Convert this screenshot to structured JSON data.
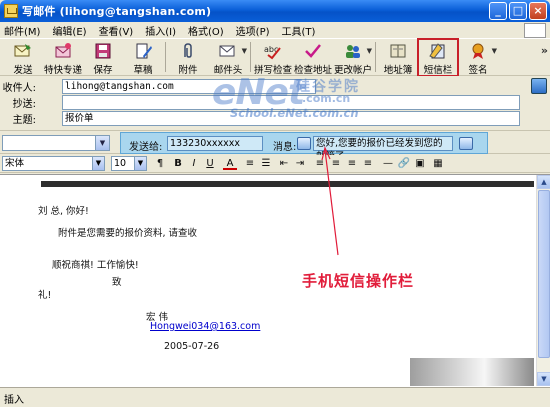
{
  "window": {
    "title": "写邮件 (lihong@tangshan.com)"
  },
  "menu": [
    "邮件(M)",
    "编辑(E)",
    "查看(V)",
    "插入(I)",
    "格式(O)",
    "选项(P)",
    "工具(T)"
  ],
  "toolbar": [
    {
      "label": "发送",
      "icon": "send-icon"
    },
    {
      "label": "特快专递",
      "icon": "express-icon"
    },
    {
      "label": "保存",
      "icon": "save-icon"
    },
    {
      "label": "草稿",
      "icon": "draft-icon"
    },
    {
      "label": "附件",
      "icon": "attachment-icon"
    },
    {
      "label": "邮件头",
      "icon": "mail-header-icon"
    },
    {
      "label": "拼写检查",
      "icon": "spellcheck-icon"
    },
    {
      "label": "检查地址",
      "icon": "check-address-icon"
    },
    {
      "label": "更改帐户",
      "icon": "change-account-icon"
    },
    {
      "label": "地址簿",
      "icon": "address-book-icon"
    },
    {
      "label": "短信栏",
      "icon": "sms-bar-icon"
    },
    {
      "label": "签名",
      "icon": "signature-icon"
    }
  ],
  "header": {
    "to_label": "收件人:",
    "to_value": "lihong@tangshan.com",
    "cc_label": "抄送:",
    "cc_value": "",
    "subject_label": "主题:",
    "subject_value": "报价单"
  },
  "sms": {
    "sender_label": "发送给:",
    "sender_value": "133230xxxxxx",
    "message_label": "消息:",
    "message_value": "您好,您要的报价已经发到您的邮箱了"
  },
  "format": {
    "font": "宋体",
    "size": "10"
  },
  "body": {
    "greeting": "刘 总, 你好!",
    "line1": "附件是您需要的报价资料, 请查收",
    "line2": "顺祝商祺! 工作愉快!",
    "closing1": "致",
    "closing2": "礼!",
    "sender_name": "宏 伟",
    "sender_email": "Hongwei034@163.com",
    "date": "2005-07-26"
  },
  "annotation": "手机短信操作栏",
  "watermark": {
    "brand": "eNet",
    "cn": "硅谷学院",
    "cn_domain": ".com.cn",
    "site": "School.eNet.com.cn"
  },
  "status": "插入",
  "colors": {
    "titlebar": "#0a5fd8",
    "highlight": "#c8202a",
    "sms_panel": "#a9d6ee",
    "annotation": "#e11c3a"
  }
}
